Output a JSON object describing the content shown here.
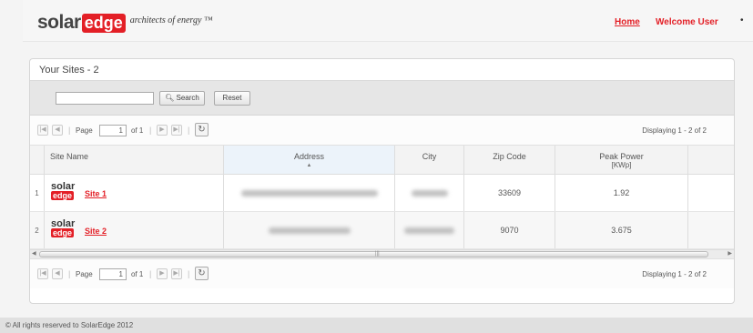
{
  "header": {
    "logo_solar": "solar",
    "logo_edge": "edge",
    "logo_tagline": "architects of energy ™",
    "nav_home": "Home",
    "nav_user": "Welcome User",
    "nav_caret": "•"
  },
  "panel": {
    "title": "Your Sites - 2"
  },
  "search": {
    "input_value": "",
    "search_label": "Search",
    "reset_label": "Reset"
  },
  "pager": {
    "page_label": "Page",
    "page_value": "1",
    "of_label": "of 1",
    "display_text": "Displaying 1 - 2 of 2"
  },
  "grid": {
    "columns": {
      "site_name": "Site Name",
      "address": "Address",
      "city": "City",
      "zip": "Zip Code",
      "peak": "Peak Power",
      "peak_unit": "[KWp]"
    },
    "rows": [
      {
        "num": "1",
        "logo_solar": "solar",
        "logo_edge": "edge",
        "name": "Site 1",
        "zip": "33609",
        "peak": "1.92"
      },
      {
        "num": "2",
        "logo_solar": "solar",
        "logo_edge": "edge",
        "name": "Site 2",
        "zip": "9070",
        "peak": "3.675"
      }
    ]
  },
  "footer": {
    "text": "© All rights reserved to SolarEdge 2012"
  },
  "colors": {
    "brand_red": "#e31f26",
    "header_bg": "#f6f6f6",
    "toolbar_bg": "#e6e6e6"
  }
}
